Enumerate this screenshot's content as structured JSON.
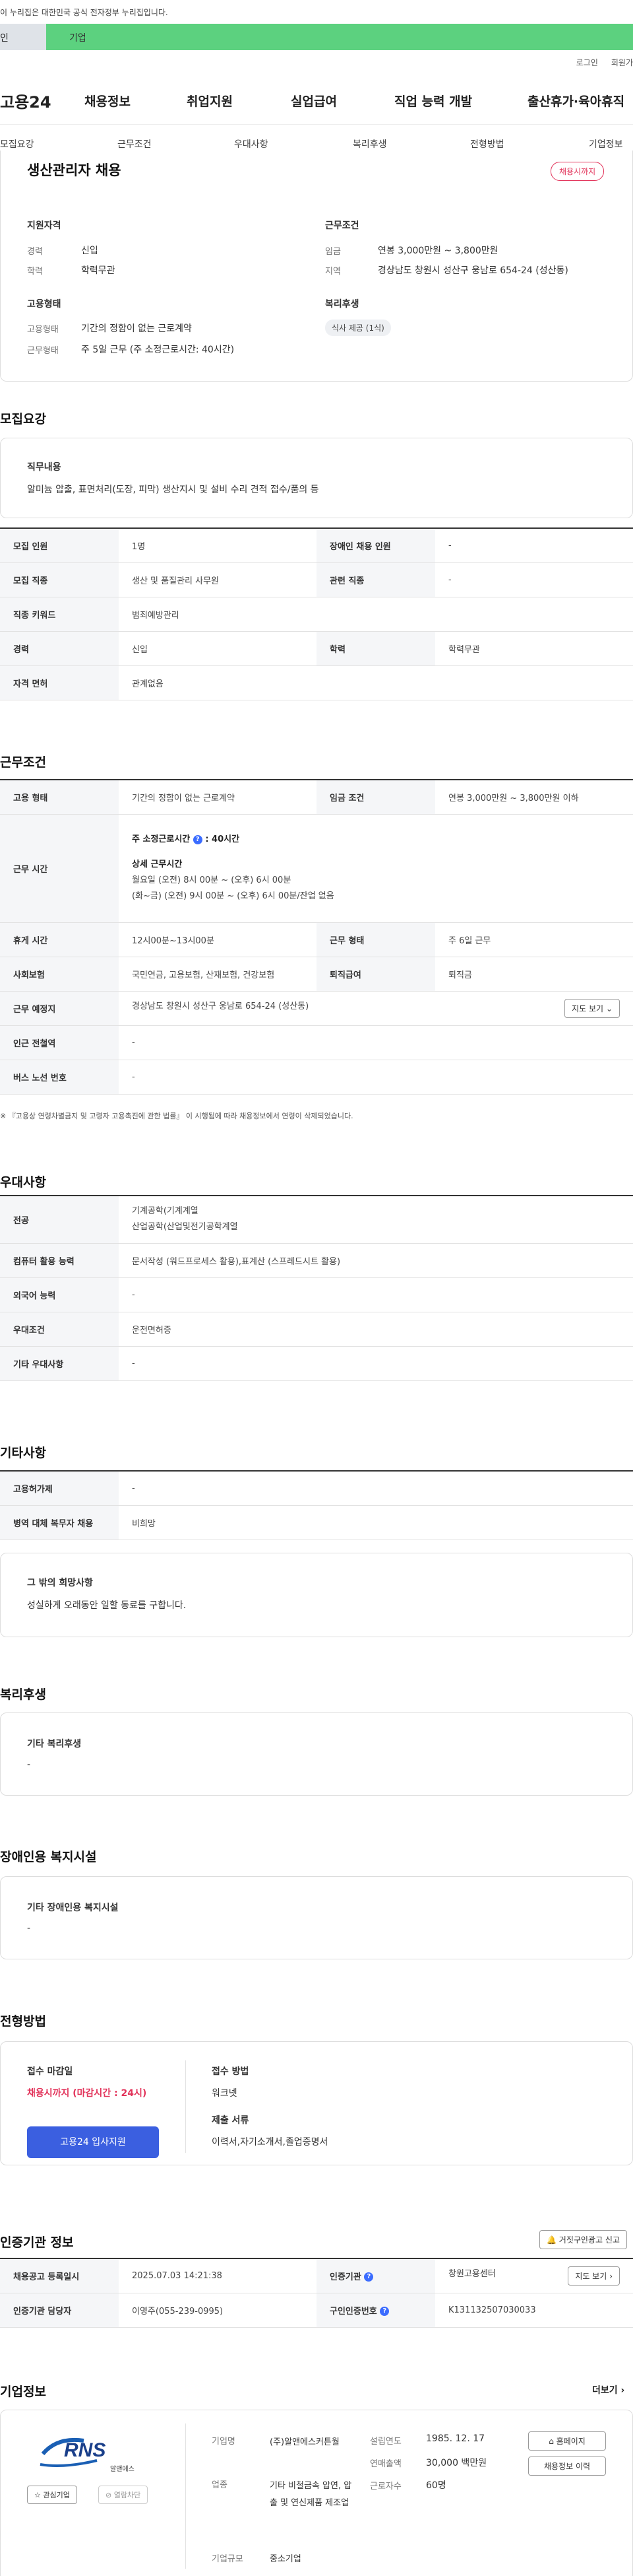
{
  "gov_banner": "이 누리집은 대한민국 공식 전자정부 누리집입니다.",
  "tabs": {
    "t1": "인",
    "t2": "기업"
  },
  "util": {
    "login": "로그인",
    "join": "회원가"
  },
  "gnb": {
    "logo": "고용24",
    "m1": "채용정보",
    "m2": "취업지원",
    "m3": "실업급여",
    "m4": "직업 능력 개발",
    "m5": "출산휴가·육아휴직"
  },
  "anchor": [
    "모집요강",
    "근무조건",
    "우대사항",
    "복리후생",
    "전형방법",
    "기업정보"
  ],
  "summary": {
    "title": "생산관리자 채용",
    "badge": "채용시까지",
    "g1": "지원자격",
    "career_l": "경력",
    "career_v": "신입",
    "edu_l": "학력",
    "edu_v": "학력무관",
    "g2": "근무조건",
    "wage_l": "임금",
    "wage_v": "연봉 3,000만원 ~ 3,800만원",
    "loc_l": "지역",
    "loc_v": "경상남도 창원시 성산구 웅남로 654-24 (성산동)",
    "g3": "고용형태",
    "emp_l": "고용형태",
    "emp_v": "기간의 정함이 없는 근로계약",
    "wt_l": "근무형태",
    "wt_v": "주 5일 근무 (주 소정근로시간: 40시간)",
    "g4": "복리후생",
    "welfare_chip": "식사 제공 (1식)"
  },
  "recruit": {
    "title": "모집요강",
    "duty_h": "직무내용",
    "duty_v": "알미늄 압출, 표면처리(도장, 피막) 생산지시 및 설비 수리 견적 접수/품의 등",
    "rows": {
      "r1a": "모집 인원",
      "r1b": "1명",
      "r1c": "장애인 채용 인원",
      "r1d": "-",
      "r2a": "모집 직종",
      "r2b": "생산 및 품질관리 사무원",
      "r2c": "관련 직종",
      "r2d": "-",
      "r3a": "직종 키워드",
      "r3b": "범죄예방관리",
      "r4a": "경력",
      "r4b": "신입",
      "r4c": "학력",
      "r4d": "학력무관",
      "r5a": "자격 면허",
      "r5b": "관계없음"
    }
  },
  "cond": {
    "title": "근무조건",
    "c1a": "고용 형태",
    "c1b": "기간의 정함이 없는 근로계약",
    "c1c": "임금 조건",
    "c1d": "연봉 3,000만원 ~ 3,800만원 이하",
    "c2a": "근무 시간",
    "c2b": "주 소정근로시간",
    "c2b2": ": 40시간",
    "c2c": "상세 근무시간",
    "c2d": "월요일  (오전) 8시 00분 ~ (오후) 6시 00분",
    "c2e": "(화~금) (오전) 9시 00분 ~ (오후) 6시 00분/잔업 없음",
    "c3a": "휴게 시간",
    "c3b": "12시00분~13시00분",
    "c3c": "근무 형태",
    "c3d": "주 6일 근무",
    "c4a": "사회보험",
    "c4b": "국민연금, 고용보험, 산재보험, 건강보험",
    "c4c": "퇴직급여",
    "c4d": "퇴직금",
    "c5a": "근무 예정지",
    "c5b": "경상남도 창원시 성산구 웅남로 654-24 (성산동)",
    "c5btn": "지도 보기",
    "c6a": "인근 전철역",
    "c6b": "-",
    "c7a": "버스 노선 번호",
    "c7b": "-",
    "note": "※ 『고용상 연령차별금지 및 고령자 고용촉진에 관한 법률』 이 시행됨에 따라 채용정보에서 연령이 삭제되었습니다."
  },
  "pref": {
    "title": "우대사항",
    "p1a": "전공",
    "p1b": "기계공학(기계계열",
    "p1c": "산업공학(산업및전기공학계열",
    "p2a": "컴퓨터 활용 능력",
    "p2b": "문서작성 (워드프로세스 활용),표계산 (스프레드시트 활용)",
    "p3a": "외국어 능력",
    "p3b": "-",
    "p4a": "우대조건",
    "p4b": "운전면허증",
    "p5a": "기타 우대사항",
    "p5b": "-"
  },
  "etc": {
    "title": "기타사항",
    "e1a": "고용허가제",
    "e1b": "-",
    "e2a": "병역 대체 복무자 채용",
    "e2b": "비희망",
    "hope_h": "그 밖의 희망사항",
    "hope_v": "성실하게 오래동안 일할 동료를 구합니다."
  },
  "welfare": {
    "title": "복리후생",
    "h": "기타 복리후생",
    "v": "-"
  },
  "disab": {
    "title": "장애인용 복지시설",
    "h": "기타 장애인용 복지시설",
    "v": "-"
  },
  "selection": {
    "title": "전형방법",
    "deadline_h": "접수 마감일",
    "deadline_v": "채용시까지 (마감시간 : 24시)",
    "apply_btn": "고용24 입사지원",
    "method_h": "접수 방법",
    "method_v": "워크넷",
    "docs_h": "제출 서류",
    "docs_v": "이력서,자기소개서,졸업증명서"
  },
  "agency": {
    "title": "인증기관 정보",
    "report_btn": "거짓구인광고 신고",
    "a1a": "채용공고 등록일시",
    "a1b": "2025.07.03 14:21:38",
    "a1c": "인증기관",
    "a1d": "창원고용센터",
    "a1btn": "지도 보기",
    "a2a": "인증기관 담당자",
    "a2b": "이영주(055-239-0995)",
    "a2c": "구인인증번호",
    "a2d": "K131132507030033"
  },
  "company": {
    "title": "기업정보",
    "more": "더보기",
    "logo_text": "RNS",
    "logo_sub": "알앤에스",
    "fav": "관심기업",
    "block": "열람차단",
    "name_l": "기업명",
    "name_v": "(주)알앤에스커튼월",
    "ind_l": "업종",
    "ind_v": "기타 비철금속 압연, 압출 및 연신제품 제조업",
    "size_l": "기업규모",
    "size_v": "중소기업",
    "est_l": "설립연도",
    "est_v": "1985. 12. 17",
    "rev_l": "연매출액",
    "rev_v": "30,000 백만원",
    "emp_l": "근로자수",
    "emp_v": "60명",
    "home_btn": "홈페이지",
    "hist_btn": "채용정보 이력"
  }
}
